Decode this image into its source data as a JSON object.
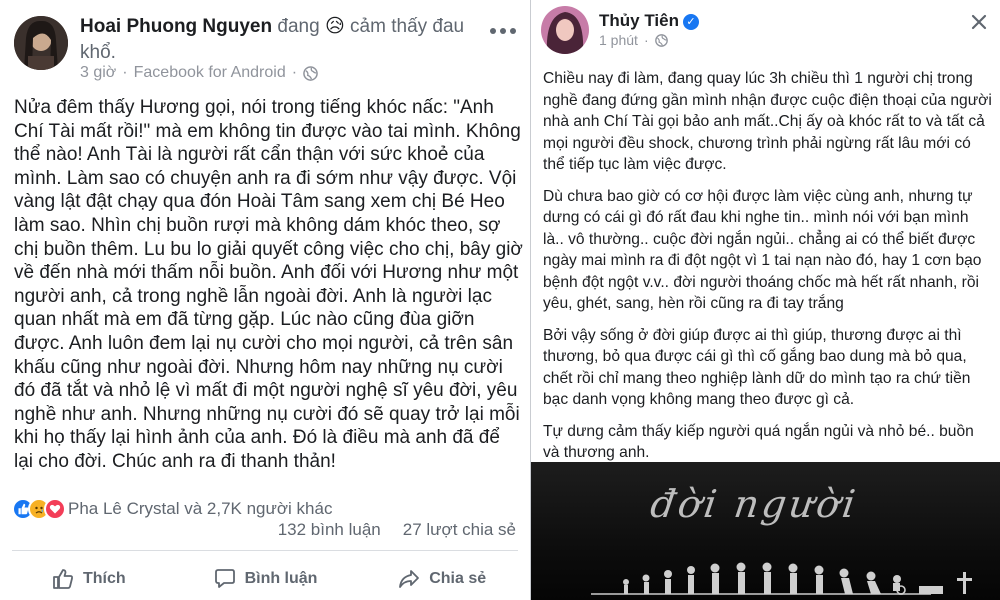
{
  "left_post": {
    "author": "Hoai Phuong Nguyen",
    "feeling_prefix": "đang",
    "feeling_emoji": "😥",
    "feeling_text": "cảm thấy đau khổ.",
    "time": "3 giờ",
    "source": "Facebook for Android",
    "privacy_icon": "globe-icon",
    "body": "Nửa đêm thấy Hương gọi, nói trong tiếng khóc nấc: \"Anh Chí Tài mất rồi!\" mà em không tin được vào tai mình. Không thể nào! Anh Tài là người rất cẩn thận với sức khoẻ của mình. Làm sao có chuyện anh ra đi sớm như vậy được. Vội vàng lật đật chạy qua đón Hoài Tâm sang xem chị Bé Heo làm sao. Nhìn chị buồn rượi mà không dám khóc theo, sợ chị buồn thêm. Lu bu lo giải quyết công việc cho chị, bây giờ về đến nhà mới thấm nỗi buồn. Anh đối với Hương như một người anh, cả trong nghề lẫn ngoài đời. Anh là người lạc quan nhất mà em đã từng gặp. Lúc nào cũng đùa giỡn được. Anh luôn đem lại nụ cười cho mọi người, cả trên sân khấu cũng như ngoài đời. Nhưng hôm nay những nụ cười đó đã tắt và nhỏ lệ vì mất đi một người nghệ sĩ yêu đời, yêu nghề như anh. Nhưng những nụ cười đó sẽ quay trở lại mỗi khi họ thấy lại hình ảnh của anh. Đó là điều mà anh đã để lại cho đời. Chúc anh ra đi thanh thản!",
    "reactions_text": "Pha Lê Crystal và 2,7K người khác",
    "reaction_icons": [
      "like-icon",
      "sad-icon",
      "love-icon"
    ],
    "comments": "132 bình luận",
    "shares": "27 lượt chia sẻ",
    "actions": {
      "like": "Thích",
      "comment": "Bình luận",
      "share": "Chia sẻ"
    }
  },
  "right_post": {
    "author": "Thủy Tiên",
    "verified_icon": "verified-badge-icon",
    "time": "1 phút",
    "privacy_icon": "globe-icon",
    "paragraphs": [
      "Chiều nay đi làm, đang quay lúc 3h chiều thì 1 người chị trong nghề đang đứng gần mình nhận được cuộc điện thoại của người nhà anh Chí Tài gọi bảo anh mất..Chị ấy oà khóc rất to và tất cả mọi người đều shock, chương trình phải ngừng rất lâu mới có thể tiếp tục làm việc được.",
      "Dù chưa bao giờ có cơ hội được làm việc cùng anh, nhưng tự dưng có cái gì đó rất đau khi nghe tin.. mình nói với bạn mình là.. vô thường.. cuộc đời ngắn ngủi.. chẳng ai có thể biết được ngày mai mình ra đi đột ngột vì 1 tai nạn nào đó, hay 1 cơn bạo bệnh đột ngột v.v.. đời người thoáng chốc mà hết rất nhanh, rồi yêu, ghét, sang, hèn rồi cũng ra đi tay trắng",
      "Bởi vậy sống ở đời giúp được ai thì giúp, thương được ai thì thương, bỏ qua được cái gì thì cố gắng bao dung mà bỏ qua, chết rồi chỉ mang theo nghiệp lành dữ do mình tạo ra chứ tiền bạc danh vọng không mang theo được gì cả.",
      "Tự dưng cảm thấy kiếp người quá ngắn ngủi và nhỏ bé.. buồn và thương anh."
    ],
    "image_title": "đời người"
  },
  "colors": {
    "text": "#1c1e21",
    "meta": "#90949c",
    "action": "#606770",
    "like_blue": "#1877f2",
    "love_red": "#f33e58",
    "sad_yellow": "#f7b125",
    "verified_blue": "#1877f2"
  }
}
